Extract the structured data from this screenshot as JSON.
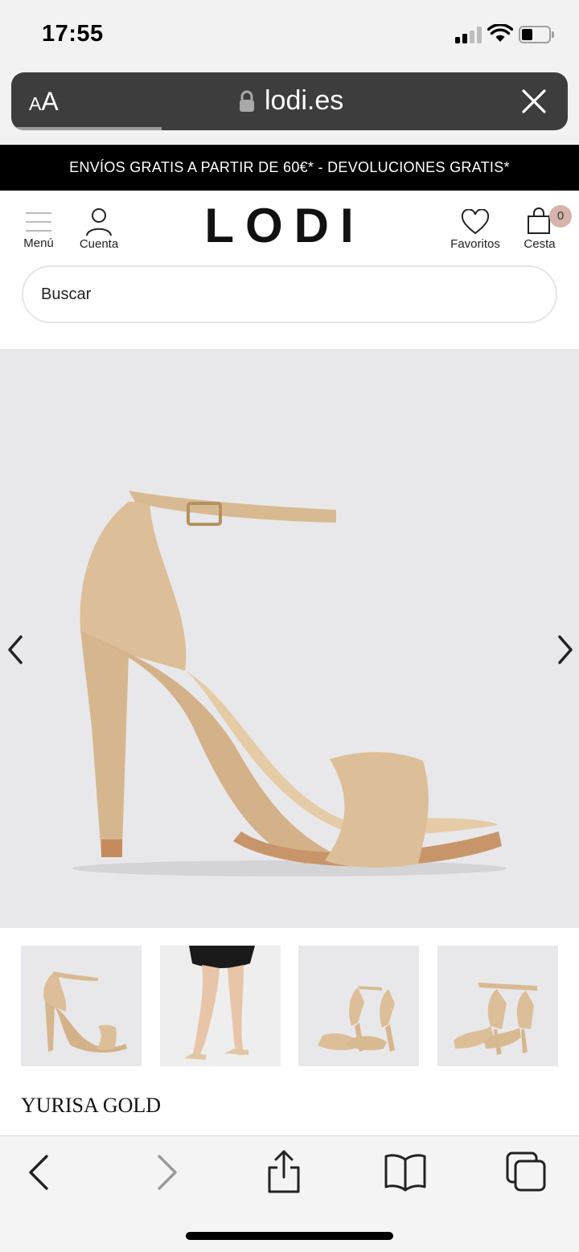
{
  "status_bar": {
    "time": "17:55"
  },
  "browser": {
    "text_size_label_small": "A",
    "text_size_label_large": "A",
    "url": "lodi.es",
    "icons": {
      "lock": "lock-icon",
      "close": "close-icon"
    }
  },
  "promo_banner": {
    "text": "ENVÍOS GRATIS A PARTIR DE 60€* - DEVOLUCIONES GRATIS*"
  },
  "header": {
    "menu_label": "Menú",
    "account_label": "Cuenta",
    "logo": "LODI",
    "favorites_label": "Favoritos",
    "cart_label": "Cesta",
    "cart_count": "0"
  },
  "search": {
    "placeholder": "Buscar"
  },
  "product": {
    "name": "YURISA GOLD",
    "image_colors": {
      "background": "#e8e8ea",
      "leather": "#d9bb94",
      "sole": "#c8956a"
    },
    "thumbnails": [
      {
        "kind": "side-view"
      },
      {
        "kind": "worn-on-legs"
      },
      {
        "kind": "front-pair"
      },
      {
        "kind": "back-pair"
      }
    ]
  },
  "toolbar": {
    "icons": [
      "back-icon",
      "forward-icon",
      "share-icon",
      "bookmarks-icon",
      "tabs-icon"
    ]
  }
}
